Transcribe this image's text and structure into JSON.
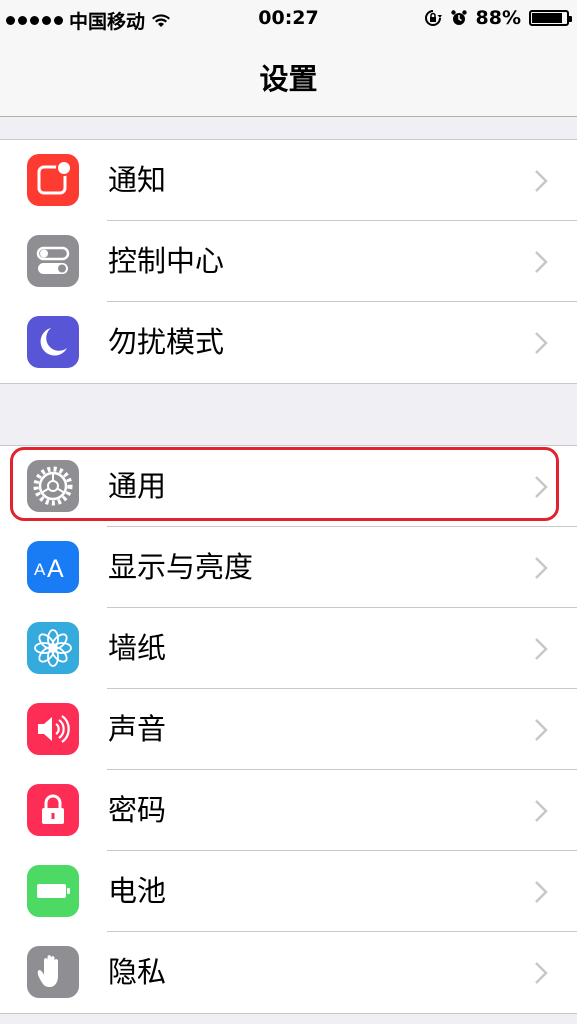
{
  "status": {
    "carrier": "中国移动",
    "time": "00:27",
    "battery_percent": "88%",
    "battery_level": 0.88
  },
  "nav": {
    "title": "设置"
  },
  "group1": [
    {
      "label": "通知",
      "icon": "notifications-icon",
      "color": "#fe3b30"
    },
    {
      "label": "控制中心",
      "icon": "control-center-icon",
      "color": "#8e8e93"
    },
    {
      "label": "勿扰模式",
      "icon": "do-not-disturb-icon",
      "color": "#5856d6"
    }
  ],
  "group2": [
    {
      "label": "通用",
      "icon": "gear-icon",
      "color": "#8e8e93",
      "highlighted": true
    },
    {
      "label": "显示与亮度",
      "icon": "display-brightness-icon",
      "color": "#1a7cf5"
    },
    {
      "label": "墙纸",
      "icon": "wallpaper-icon",
      "color": "#35aadc"
    },
    {
      "label": "声音",
      "icon": "sound-icon",
      "color": "#fe2d55"
    },
    {
      "label": "密码",
      "icon": "passcode-icon",
      "color": "#fe2d55"
    },
    {
      "label": "电池",
      "icon": "battery-icon",
      "color": "#4cd964"
    },
    {
      "label": "隐私",
      "icon": "privacy-hand-icon",
      "color": "#8e8e93"
    }
  ]
}
